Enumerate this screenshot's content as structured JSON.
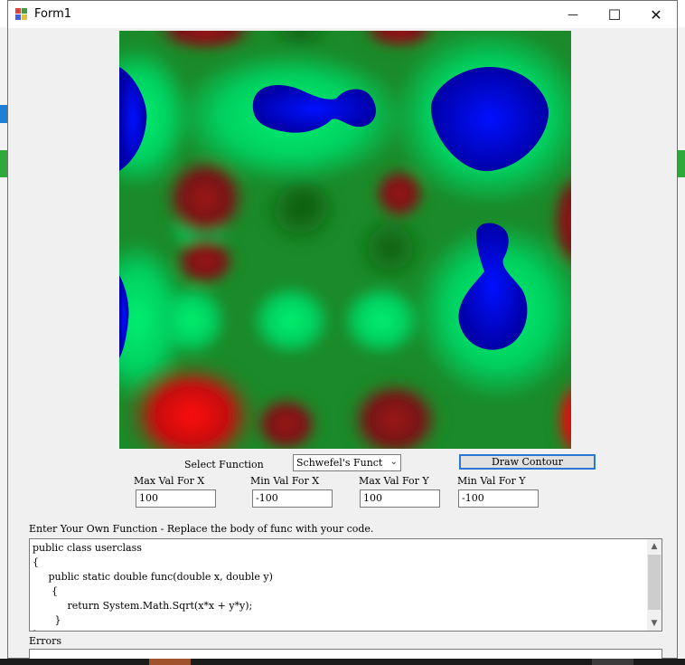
{
  "window": {
    "title": "Form1",
    "minimize": "—",
    "maximize": "☐",
    "close": "✕"
  },
  "controls": {
    "select_function_label": "Select Function",
    "function_selected": "Schwefel's Funct",
    "draw_button": "Draw Contour",
    "max_x_label": "Max Val For X",
    "min_x_label": "Min Val For X",
    "max_y_label": "Max Val For Y",
    "min_y_label": "Min Val For Y",
    "max_x": "100",
    "min_x": "-100",
    "max_y": "100",
    "min_y": "-100"
  },
  "editor": {
    "label": "Enter Your Own Function - Replace the body of func with your code.",
    "code": "public class userclass\n{\n     public static double func(double x, double y)\n      {\n           return System.Math.Sqrt(x*x + y*y);\n       }\n}"
  },
  "errors": {
    "label": "Errors"
  },
  "colors": {
    "accent": "#2a78d4",
    "low": "#0000cc",
    "mid": "#00e060",
    "high": "#ff0000"
  }
}
